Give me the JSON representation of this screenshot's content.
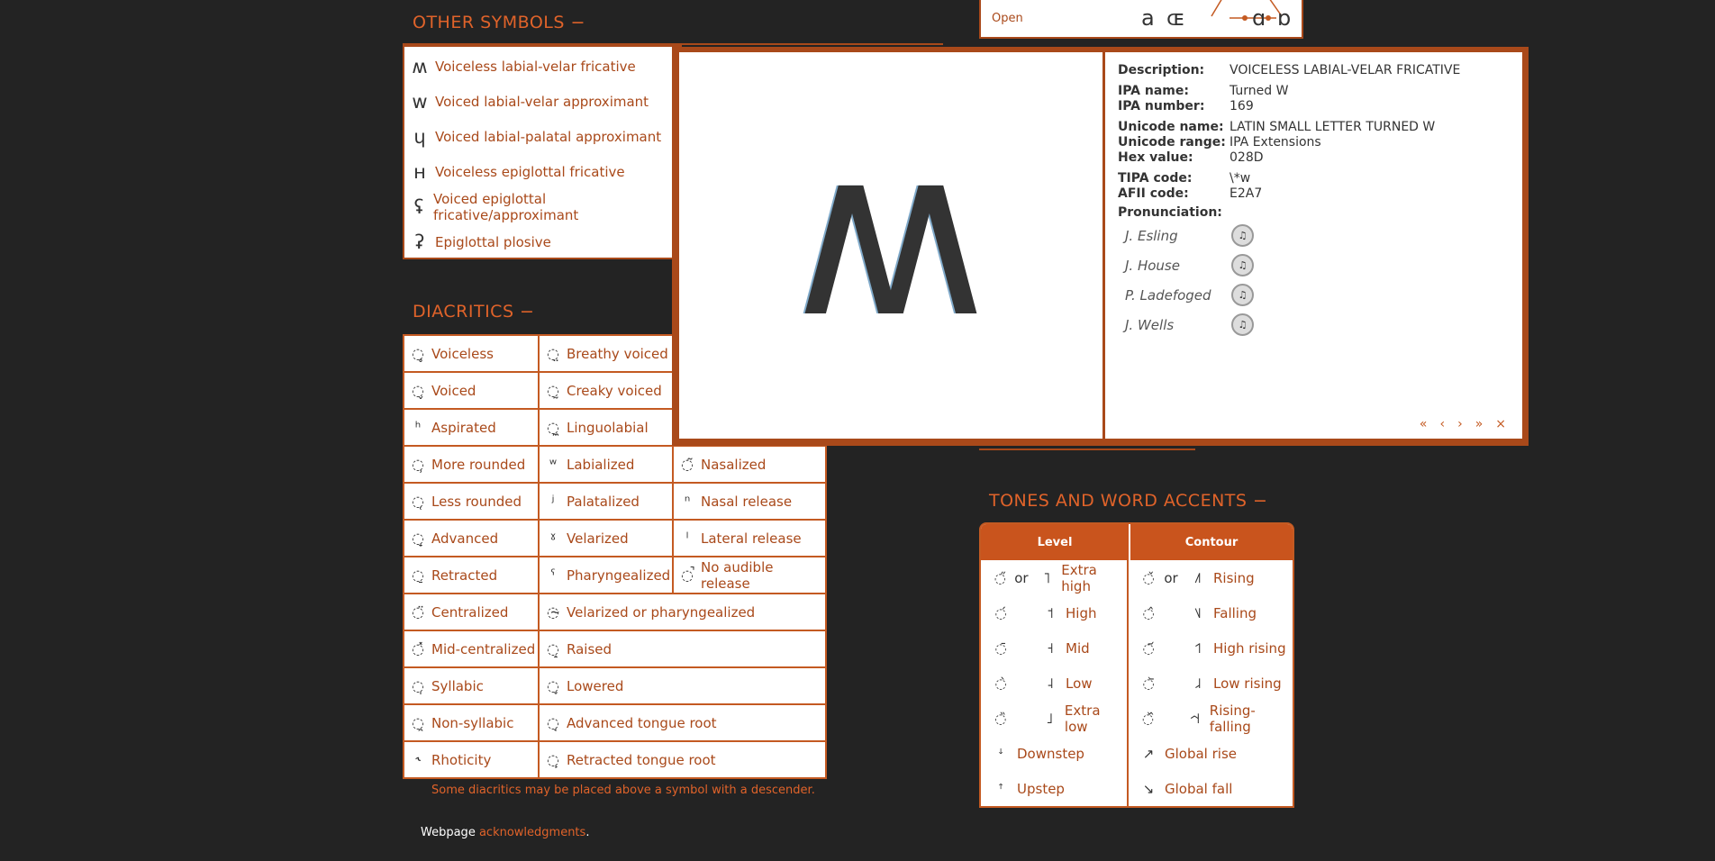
{
  "other_symbols": {
    "heading": "OTHER SYMBOLS −",
    "items": [
      {
        "symbol": "ʍ",
        "label": "Voiceless labial-velar fricative"
      },
      {
        "symbol": "w",
        "label": "Voiced labial-velar approximant"
      },
      {
        "symbol": "ɥ",
        "label": "Voiced labial-palatal approximant"
      },
      {
        "symbol": "ʜ",
        "label": "Voiceless epiglottal fricative"
      },
      {
        "symbol": "ʢ",
        "label": "Voiced epiglottal fricative/approximant"
      },
      {
        "symbol": "ʡ",
        "label": "Epiglottal plosive"
      }
    ]
  },
  "vowel_top": {
    "label": "Open",
    "symbols": [
      "a",
      "ɶ",
      "ɑ",
      "ɒ"
    ]
  },
  "diacritics": {
    "heading": "DIACRITICS −",
    "note": "Some diacritics may be placed above a symbol with a descender.",
    "col1": [
      {
        "d": "◌̥",
        "label": "Voiceless"
      },
      {
        "d": "◌̬",
        "label": "Voiced"
      },
      {
        "d": "ʰ",
        "label": "Aspirated"
      },
      {
        "d": "◌̹",
        "label": "More rounded"
      },
      {
        "d": "◌̜",
        "label": "Less rounded"
      },
      {
        "d": "◌̟",
        "label": "Advanced"
      },
      {
        "d": "◌̠",
        "label": "Retracted"
      },
      {
        "d": "◌̈",
        "label": "Centralized"
      },
      {
        "d": "◌̽",
        "label": "Mid-centralized"
      },
      {
        "d": "◌̩",
        "label": "Syllabic"
      },
      {
        "d": "◌̯",
        "label": "Non-syllabic"
      },
      {
        "d": "˞",
        "label": "Rhoticity"
      }
    ],
    "col2": [
      {
        "d": "◌̤",
        "label": "Breathy voiced"
      },
      {
        "d": "◌̰",
        "label": "Creaky voiced"
      },
      {
        "d": "◌̼",
        "label": "Linguolabial"
      },
      {
        "d": "ʷ",
        "label": "Labialized"
      },
      {
        "d": "ʲ",
        "label": "Palatalized"
      },
      {
        "d": "ˠ",
        "label": "Velarized"
      },
      {
        "d": "ˤ",
        "label": "Pharyngealized"
      },
      {
        "d": "◌̴",
        "label": "Velarized or pharyngealized"
      },
      {
        "d": "◌̝",
        "label": "Raised"
      },
      {
        "d": "◌̞",
        "label": "Lowered"
      },
      {
        "d": "◌̘",
        "label": "Advanced tongue root"
      },
      {
        "d": "◌̙",
        "label": "Retracted tongue root"
      }
    ],
    "col3": [
      {
        "d": "◌̃",
        "label": "Nasalized"
      },
      {
        "d": "ⁿ",
        "label": "Nasal release"
      },
      {
        "d": "ˡ",
        "label": "Lateral release"
      },
      {
        "d": "◌̚",
        "label": "No audible release"
      }
    ]
  },
  "tones": {
    "heading": "TONES AND WORD ACCENTS −",
    "level_header": "Level",
    "contour_header": "Contour",
    "or": "or",
    "level": [
      {
        "d": "◌̋",
        "t": "˥",
        "label": "Extra high",
        "or": true
      },
      {
        "d": "◌́",
        "t": "˦",
        "label": "High"
      },
      {
        "d": "◌̄",
        "t": "˧",
        "label": "Mid"
      },
      {
        "d": "◌̀",
        "t": "˨",
        "label": "Low"
      },
      {
        "d": "◌̏",
        "t": "˩",
        "label": "Extra low"
      },
      {
        "d": "ꜜ",
        "t": "",
        "label": "Downstep"
      },
      {
        "d": "ꜛ",
        "t": "",
        "label": "Upstep"
      }
    ],
    "contour": [
      {
        "d": "◌̌",
        "t": "˩˥",
        "label": "Rising",
        "or": true
      },
      {
        "d": "◌̂",
        "t": "˥˩",
        "label": "Falling"
      },
      {
        "d": "◌᷄",
        "t": "˦˥",
        "label": "High rising"
      },
      {
        "d": "◌᷅",
        "t": "˩˨",
        "label": "Low rising"
      },
      {
        "d": "◌᷈",
        "t": "˧˦˧",
        "label": "Rising-falling"
      },
      {
        "d": "↗",
        "t": "",
        "label": "Global rise"
      },
      {
        "d": "↘",
        "t": "",
        "label": "Global fall"
      }
    ]
  },
  "footer": {
    "prefix": "Webpage",
    "link": "acknowledgments",
    "suffix": "."
  },
  "popup": {
    "big_symbol": "ʍ",
    "fields": [
      {
        "k": "Description:",
        "v": "VOICELESS LABIAL-VELAR FRICATIVE"
      },
      {
        "k": "IPA name:",
        "v": "Turned W"
      },
      {
        "k": "IPA number:",
        "v": "169"
      },
      {
        "k": "Unicode name:",
        "v": "LATIN SMALL LETTER TURNED W"
      },
      {
        "k": "Unicode range:",
        "v": "IPA Extensions"
      },
      {
        "k": "Hex value:",
        "v": "028D"
      },
      {
        "k": "TIPA code:",
        "v": "\\*w"
      },
      {
        "k": "AFII code:",
        "v": "E2A7"
      }
    ],
    "pronunciation_label": "Pronunciation:",
    "speakers": [
      "J. Esling",
      "J. House",
      "P. Ladefoged",
      "J. Wells"
    ],
    "nav": [
      "«",
      "‹",
      "›",
      "»",
      "×"
    ]
  }
}
